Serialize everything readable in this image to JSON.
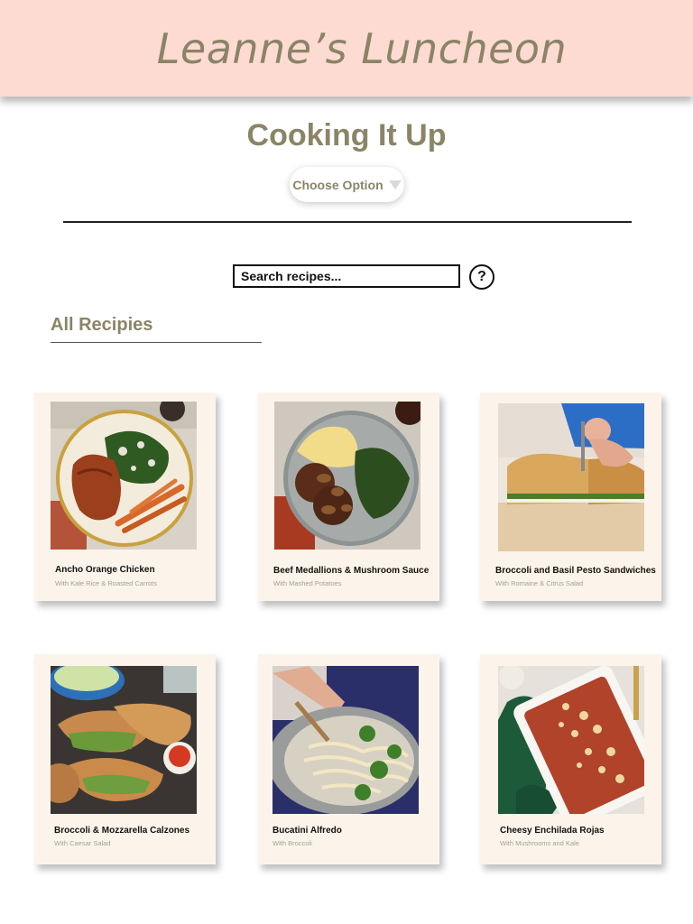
{
  "header": {
    "site_title": "Leanne’s Luncheon"
  },
  "page": {
    "title": "Cooking It Up"
  },
  "options": {
    "selected_label": "Choose Option"
  },
  "search": {
    "placeholder": "Search recipes...",
    "help_label": "?"
  },
  "section": {
    "heading": "All Recipies"
  },
  "recipes": [
    {
      "title": "Ancho Orange Chicken",
      "subtitle": "With Kale Rice & Roasted Carrots"
    },
    {
      "title": "Beef Medallions & Mushroom Sauce",
      "subtitle": "With Mashed Potatoes"
    },
    {
      "title": "Broccoli and Basil Pesto Sandwiches",
      "subtitle": "With Romaine & Citrus Salad"
    },
    {
      "title": "Broccoli & Mozzarella Calzones",
      "subtitle": "With Caesar Salad"
    },
    {
      "title": "Bucatini Alfredo",
      "subtitle": "With Broccoli"
    },
    {
      "title": "Cheesy Enchilada Rojas",
      "subtitle": "With Mushrooms and Kale"
    }
  ],
  "colors": {
    "header_bg": "#fddbd2",
    "accent_olive": "#8b8466",
    "card_bg": "#fcf4ea"
  }
}
